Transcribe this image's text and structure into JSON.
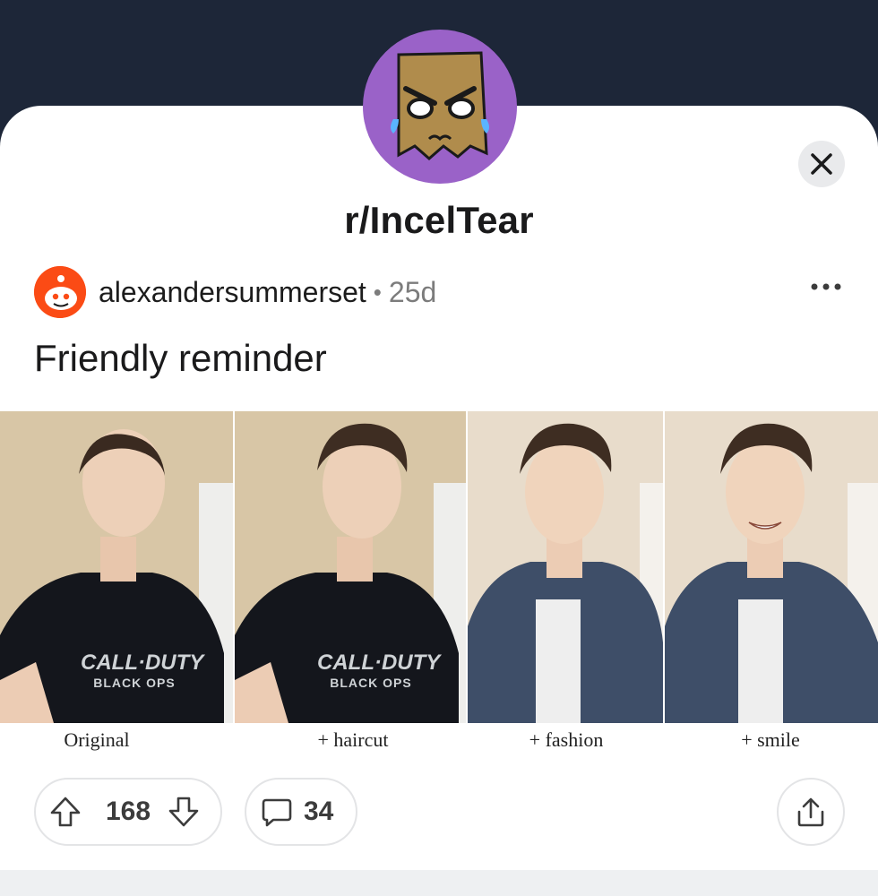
{
  "subreddit": {
    "name": "r/IncelTear",
    "avatar_icon": "paper-bag-crying-face-icon",
    "avatar_color": "#9a62c8"
  },
  "header": {
    "close_icon": "close-icon"
  },
  "post": {
    "author": "alexandersummerset",
    "separator": "•",
    "age": "25d",
    "title": "Friendly reminder",
    "more_icon": "more-horizontal-icon",
    "image": {
      "panels": [
        {
          "caption": "Original",
          "shirt": "CALL·DUTY",
          "shirt_sub": "BLACK OPS"
        },
        {
          "caption": "+ haircut",
          "shirt": "CALL·DUTY",
          "shirt_sub": "BLACK OPS"
        },
        {
          "caption": "+ fashion"
        },
        {
          "caption": "+ smile"
        }
      ]
    }
  },
  "actions": {
    "upvotes": "168",
    "comments": "34",
    "upvote_icon": "upvote-arrow-icon",
    "downvote_icon": "downvote-arrow-icon",
    "comment_icon": "comment-bubble-icon",
    "share_icon": "share-icon"
  },
  "colors": {
    "topbar": "#1d2638",
    "reddit_orange": "#fb4b15",
    "muted": "#7c7c7c"
  }
}
